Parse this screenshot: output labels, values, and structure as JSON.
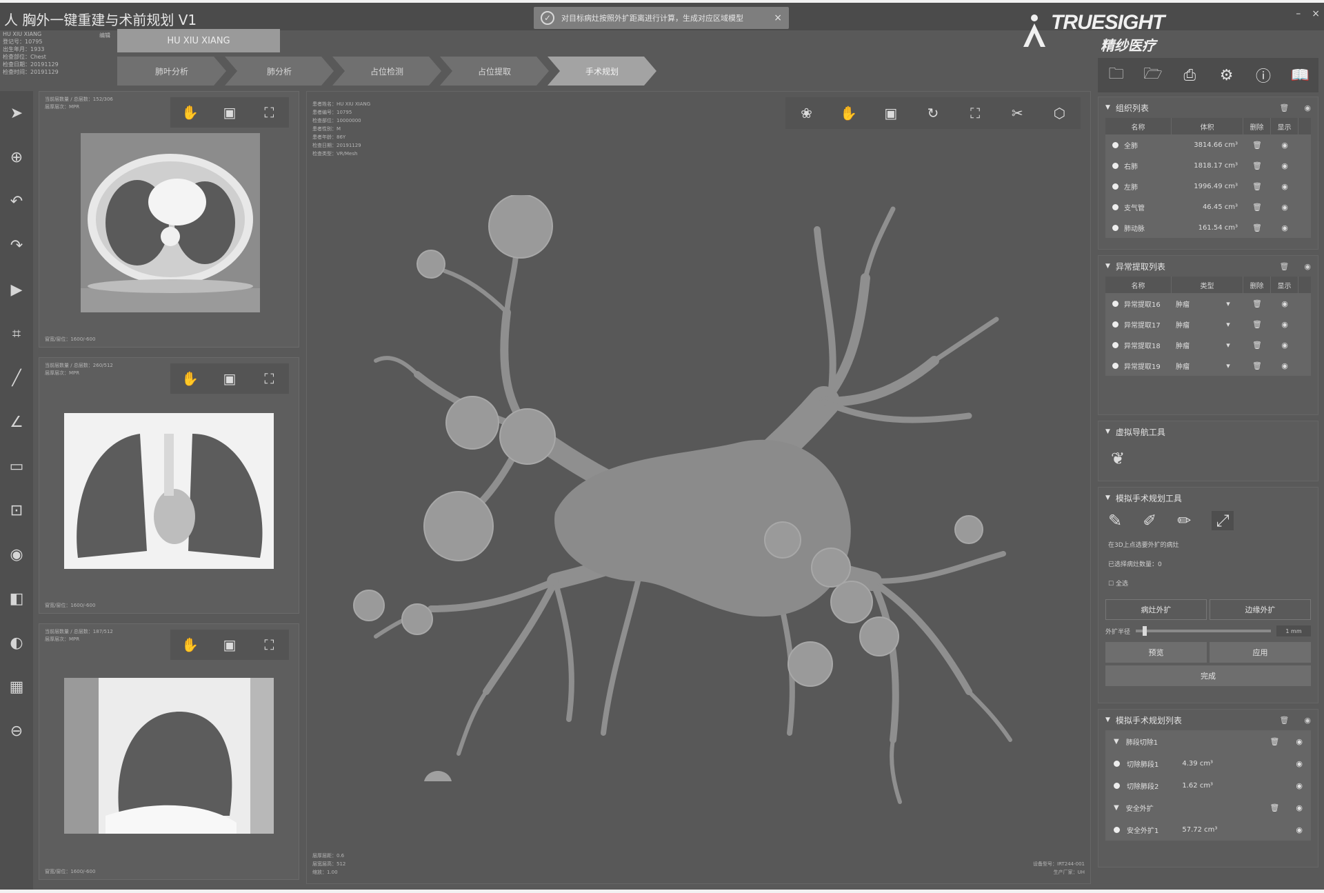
{
  "window": {
    "title": "人 胸外一键重建与术前规划 V1",
    "toast_message": "对目标病灶按照外扩距离进行计算，生成对应区域模型",
    "toast_close": "×",
    "brand": "TRUESIGHT",
    "brand_cn": "精纱医疗",
    "min_btn": "–",
    "close_btn": "×"
  },
  "patient": {
    "lines": [
      "HU XIU XIANG",
      "登记号：10795",
      "出生年月：1933",
      "检查部位：Chest",
      "检查日期：20191129",
      "检查时间：20191129"
    ],
    "edit": "编辑",
    "name_tab": "HU XIU XIANG"
  },
  "steps": [
    "肺叶分析",
    "肺分析",
    "占位检测",
    "占位提取",
    "手术规划"
  ],
  "active_step": 4,
  "left_tools": [
    "pointer-icon",
    "crosshair-icon",
    "undo-icon",
    "redo-icon",
    "video-icon",
    "crop-icon",
    "ruler-icon",
    "angle-icon",
    "annotation-icon",
    "focus-icon",
    "eye-icon",
    "layout-icon",
    "contrast-icon",
    "grid-icon",
    "minus-circle-icon"
  ],
  "views": [
    {
      "info": [
        "当前层数量 / 总层数：152/306",
        "层厚层次：MPR"
      ],
      "wl": "窗宽/窗位：1600/-600"
    },
    {
      "info": [
        "当前层数量 / 总层数：260/512",
        "层厚层次：MPR"
      ],
      "wl": "窗宽/窗位：1600/-600"
    },
    {
      "info": [
        "当前层数量 / 总层数：187/512",
        "层厚层次：MPR"
      ],
      "wl": "窗宽/窗位：1600/-600"
    }
  ],
  "main3d": {
    "info": [
      "患者姓名：HU XIU XIANG",
      "患者编号：10795",
      "检查部位：10000000",
      "患者性别：M",
      "患者年龄：86Y",
      "检查日期：20191129",
      "检查类型：VR/Mesh"
    ],
    "bottom_left": [
      "层厚层距：0.6",
      "层宽层高：512",
      "缩放：1.00"
    ],
    "bottom_right": [
      "设备型号：IRT244-001",
      "生产厂家：UH"
    ]
  },
  "panels": {
    "tissue": {
      "title": "组织列表",
      "cols": [
        "名称",
        "体积",
        "删除",
        "显示"
      ],
      "rows": [
        {
          "name": "全肺",
          "vol": "3814.66 cm³"
        },
        {
          "name": "右肺",
          "vol": "1818.17 cm³"
        },
        {
          "name": "左肺",
          "vol": "1996.49 cm³"
        },
        {
          "name": "支气管",
          "vol": "46.45 cm³"
        },
        {
          "name": "肺动脉",
          "vol": "161.54 cm³"
        }
      ]
    },
    "abnormal": {
      "title": "异常提取列表",
      "cols": [
        "名称",
        "类型",
        "删除",
        "显示"
      ],
      "rows": [
        {
          "name": "异常提取16",
          "type": "肿瘤"
        },
        {
          "name": "异常提取17",
          "type": "肿瘤"
        },
        {
          "name": "异常提取18",
          "type": "肿瘤"
        },
        {
          "name": "异常提取19",
          "type": "肿瘤"
        }
      ]
    },
    "nav": {
      "title": "虚拟导航工具"
    },
    "sim": {
      "title": "模拟手术规划工具",
      "hint": "在3D上点选要外扩的病灶",
      "selected": "已选择病灶数量：0",
      "all": "全选",
      "btn_outward": "病灶外扩",
      "btn_edge": "边缘外扩",
      "radius_label": "外扩半径",
      "radius_value": "1 mm",
      "radius_fraction": 0.05,
      "btn_preview": "预览",
      "btn_apply": "应用",
      "btn_done": "完成"
    },
    "plan": {
      "title": "模拟手术规划列表",
      "groups": [
        {
          "name": "肺段切除1",
          "items": [
            {
              "name": "切除肺段1",
              "vol": "4.39 cm³"
            },
            {
              "name": "切除肺段2",
              "vol": "1.62 cm³"
            }
          ]
        },
        {
          "name": "安全外扩",
          "items": [
            {
              "name": "安全外扩1",
              "vol": "57.72 cm³"
            }
          ]
        }
      ]
    }
  }
}
